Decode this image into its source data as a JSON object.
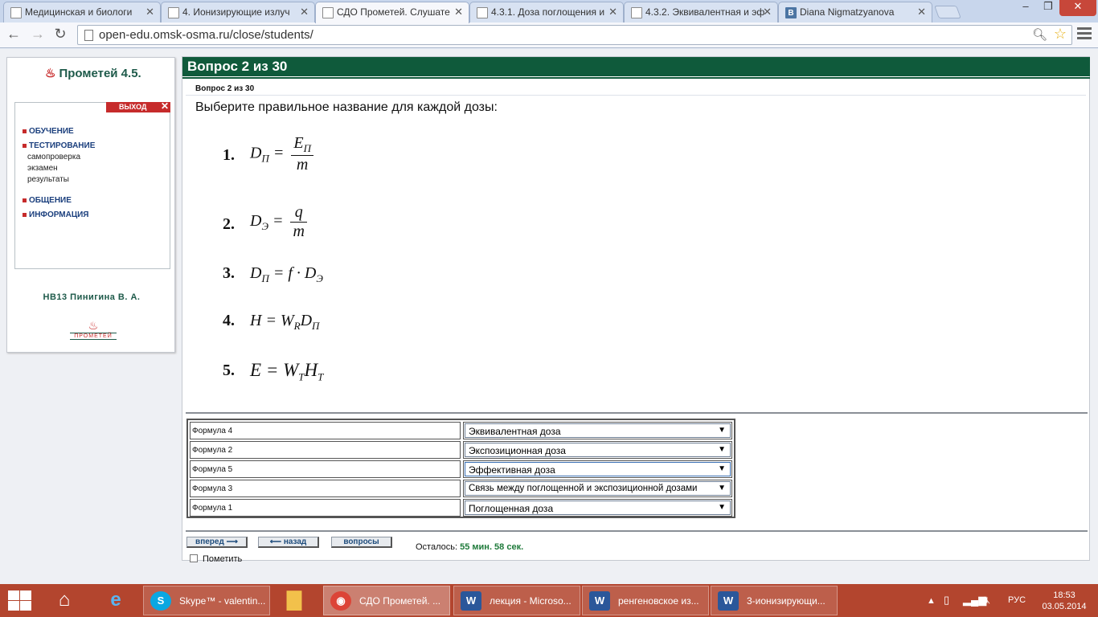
{
  "browser": {
    "tabs": [
      {
        "title": "Медицинская и биологи",
        "icon": "page-icon"
      },
      {
        "title": "4. Ионизирующие излуч",
        "icon": "page-icon"
      },
      {
        "title": "СДО Прометей. Слушате",
        "icon": "page-icon",
        "active": true
      },
      {
        "title": "4.3.1. Доза поглощения и",
        "icon": "page-icon"
      },
      {
        "title": "4.3.2. Эквивалентная и эф",
        "icon": "page-icon"
      },
      {
        "title": "Diana Nigmatzyanova",
        "icon": "vk-icon",
        "badge": "B"
      }
    ],
    "url": "open-edu.omsk-osma.ru/close/students/"
  },
  "sidebar": {
    "logo": "Прометей 4.5.",
    "exit_label": "ВЫХОД",
    "menu": {
      "study": "ОБУЧЕНИЕ",
      "testing": "ТЕСТИРОВАНИЕ",
      "testing_sub": [
        "самопроверка",
        "экзамен",
        "результаты"
      ],
      "communication": "ОБЩЕНИЕ",
      "information": "ИНФОРМАЦИЯ"
    },
    "author": "НВ13 Пинигина В. А.",
    "small_logo": "ПРОМЕТЕЙ"
  },
  "question": {
    "header": "Вопрос 2 из 30",
    "subheader": "Вопрос 2 из 30",
    "text": "Выберите правильное название для каждой дозы:",
    "formulas": [
      {
        "num": "1.",
        "lhs": "D",
        "lhs_sub": "П",
        "eq": "=",
        "numer": "E",
        "numer_sub": "П",
        "denom": "m"
      },
      {
        "num": "2.",
        "lhs": "D",
        "lhs_sub": "Э",
        "eq": "=",
        "numer": "q",
        "numer_sub": "",
        "denom": "m"
      },
      {
        "num": "3.",
        "lhs": "D",
        "lhs_sub": "П",
        "rest": "= f · D",
        "rest_sub": "Э"
      },
      {
        "num": "4.",
        "lhs": "H",
        "lhs_sub": "",
        "rest": "= W",
        "rest_sub": "R",
        "rest2": "D",
        "rest2_sub": "П"
      },
      {
        "num": "5.",
        "lhs": "E",
        "lhs_sub": "",
        "rest": "= W",
        "rest_sub": "T",
        "rest2": "H",
        "rest2_sub": "T"
      }
    ],
    "answers": [
      {
        "label": "Формула 4",
        "value": "Эквивалентная доза"
      },
      {
        "label": "Формула 2",
        "value": "Экспозиционная доза"
      },
      {
        "label": "Формула 5",
        "value": "Эффективная доза"
      },
      {
        "label": "Формула 3",
        "value": "Связь между поглощенной и экспозиционной дозами"
      },
      {
        "label": "Формула 1",
        "value": "Поглощенная доза"
      }
    ],
    "buttons": {
      "forward": "вперед",
      "back": "назад",
      "questions": "вопросы"
    },
    "timer_label": "Осталось:",
    "timer_value": "55 мин. 58 сек.",
    "mark_label": "Пометить"
  },
  "taskbar": {
    "tasks": [
      {
        "title": "Skype™ - valentin...",
        "icon": "skype-icon",
        "color": "#0aa7e1"
      },
      {
        "title": "СДО Прометей. ...",
        "icon": "chrome-icon",
        "color": "#dc4437",
        "active": true
      },
      {
        "title": "лекция - Microso...",
        "icon": "word-icon",
        "color": "#2b579a"
      },
      {
        "title": "ренгеновское из...",
        "icon": "word-icon",
        "color": "#2b579a"
      },
      {
        "title": "3-ионизирующи...",
        "icon": "word-icon",
        "color": "#2b579a"
      }
    ],
    "language": "РУС",
    "time": "18:53",
    "date": "03.05.2014"
  }
}
